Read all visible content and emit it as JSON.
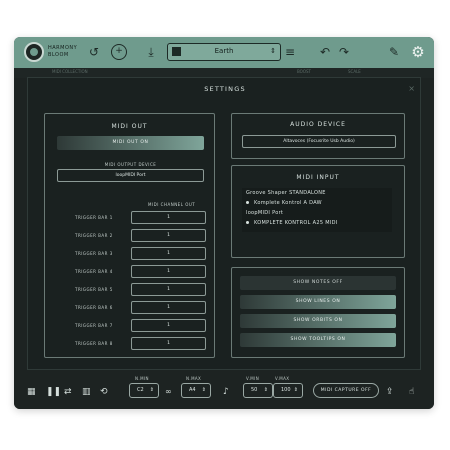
{
  "app": {
    "logo_line1": "HARMONY",
    "logo_line2": "BLOOM",
    "preset": "Earth"
  },
  "background_labels": [
    "MIDI COLLECTION",
    "BOOST",
    "SCALE"
  ],
  "settings": {
    "title": "SETTINGS",
    "close": "×",
    "midi_out": {
      "title": "MIDI OUT",
      "toggle": "MIDI OUT ON",
      "device_label": "MIDI OUTPUT DEVICE",
      "device": "loopMIDI Port",
      "channel_header": "MIDI CHANNEL OUT",
      "trigger_bars": [
        {
          "label": "TRIGGER BAR 1",
          "channel": "1"
        },
        {
          "label": "TRIGGER BAR 2",
          "channel": "1"
        },
        {
          "label": "TRIGGER BAR 3",
          "channel": "1"
        },
        {
          "label": "TRIGGER BAR 4",
          "channel": "1"
        },
        {
          "label": "TRIGGER BAR 5",
          "channel": "1"
        },
        {
          "label": "TRIGGER BAR 6",
          "channel": "1"
        },
        {
          "label": "TRIGGER BAR 7",
          "channel": "1"
        },
        {
          "label": "TRIGGER BAR 8",
          "channel": "1"
        }
      ]
    },
    "audio_device": {
      "title": "AUDIO DEVICE",
      "device": "Altavoces (Focusrite Usb Audio)"
    },
    "midi_input": {
      "title": "MIDI INPUT",
      "devices": [
        {
          "name": "Groove Shaper STANDALONE",
          "selected": false
        },
        {
          "name": "Komplete Kontrol A DAW",
          "selected": true
        },
        {
          "name": "loopMIDI Port",
          "selected": false
        },
        {
          "name": "KOMPLETE KONTROL A25 MIDI",
          "selected": true
        }
      ]
    },
    "toggles": {
      "notes": "SHOW NOTES OFF",
      "lines": "SHOW LINES ON",
      "orbits": "SHOW ORBITS ON",
      "tooltips": "SHOW TOOLTIPS ON"
    }
  },
  "bottom": {
    "n_min_label": "N.MIN",
    "n_min": "C2",
    "n_max_label": "N.MAX",
    "n_max": "A4",
    "v_min_label": "V.MIN",
    "v_min": "50",
    "v_max_label": "V.MAX",
    "v_max": "100",
    "capture": "MIDI CAPTURE OFF"
  },
  "colors": {
    "accent": "#6f9b8d",
    "background": "#1d2322"
  },
  "icons": [
    "logo-icon",
    "undo-icon",
    "add-icon",
    "download-icon",
    "preset-icon",
    "menu-icon",
    "undo-arrow-icon",
    "redo-arrow-icon",
    "brush-icon",
    "gear-icon",
    "grid-icon",
    "pause-icon",
    "shuffle-icon",
    "piano-icon",
    "loop-icon",
    "infinity-icon",
    "tuning-icon",
    "export-icon",
    "hand-icon"
  ]
}
